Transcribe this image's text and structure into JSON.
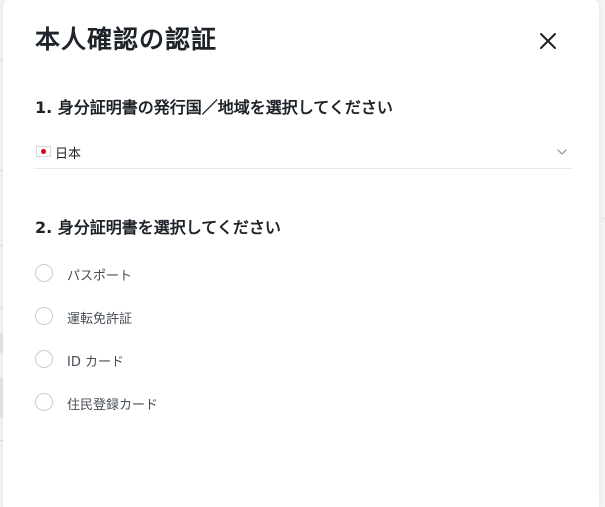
{
  "dialog": {
    "title": "本人確認の認証",
    "close_icon": "close-icon"
  },
  "section_country": {
    "title": "1. 身分証明書の発行国／地域を選択してください",
    "selected_value": "日本",
    "flag_icon": "japan-flag-icon",
    "dropdown_icon": "chevron-down-icon"
  },
  "section_document": {
    "title": "2. 身分証明書を選択してください",
    "options": [
      {
        "label": "パスポート",
        "selected": false
      },
      {
        "label": "運転免許証",
        "selected": false
      },
      {
        "label": "ID カード",
        "selected": false
      },
      {
        "label": "住民登録カード",
        "selected": false
      }
    ]
  },
  "colors": {
    "text_primary": "#1e2329",
    "text_secondary": "#474d57",
    "border": "#e6e8ea",
    "radio_border": "#c9cdd2"
  }
}
